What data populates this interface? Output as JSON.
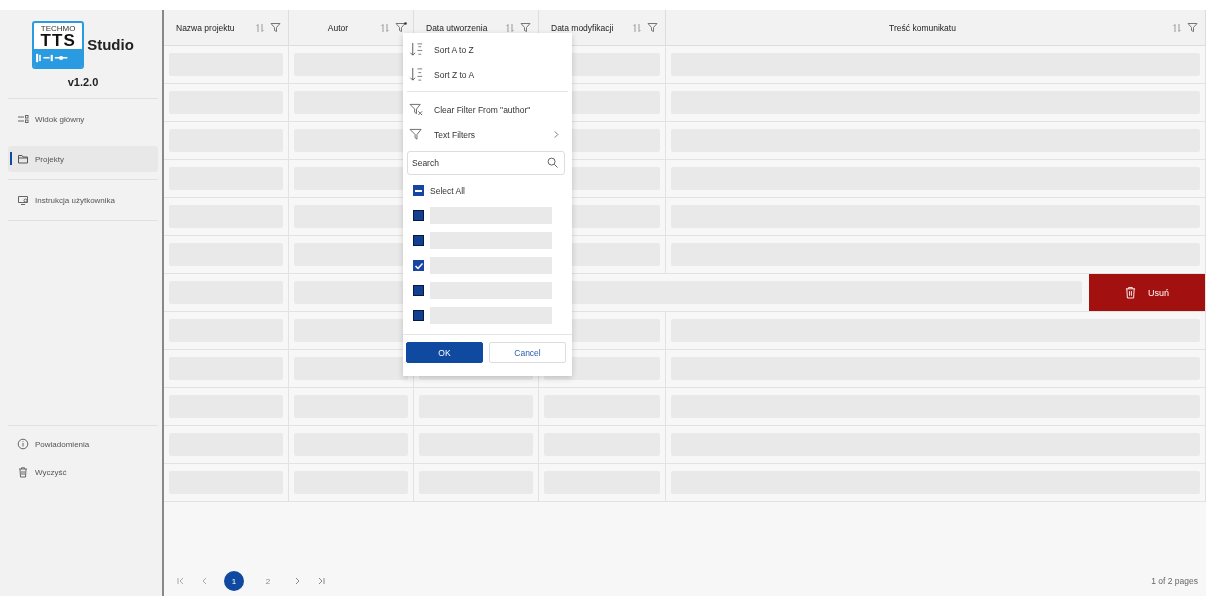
{
  "sidebar": {
    "logo": {
      "brand": "TECHMO",
      "product": "TTS",
      "suffix": "Studio"
    },
    "version": "v1.2.0",
    "nav": [
      {
        "label": "Widok główny",
        "selected": false
      },
      {
        "label": "Projekty",
        "selected": true
      },
      {
        "label": "Instrukcja użytkownika",
        "selected": false
      }
    ],
    "bottom": [
      {
        "label": "Powiadomienia"
      },
      {
        "label": "Wyczyść"
      }
    ]
  },
  "table": {
    "columns": [
      {
        "label": "Nazwa projektu",
        "filtered": false
      },
      {
        "label": "Autor",
        "filtered": true
      },
      {
        "label": "Data utworzenia",
        "filtered": false
      },
      {
        "label": "Data modyfikacji",
        "filtered": false
      },
      {
        "label": "Treść komunikatu",
        "filtered": false
      }
    ],
    "rows": [
      {
        "kind": "loading"
      },
      {
        "kind": "loading"
      },
      {
        "kind": "loading"
      },
      {
        "kind": "loading"
      },
      {
        "kind": "loading"
      },
      {
        "kind": "loading"
      },
      {
        "kind": "swiped",
        "action": "Usuń"
      },
      {
        "kind": "loading"
      },
      {
        "kind": "loading"
      },
      {
        "kind": "loading"
      },
      {
        "kind": "loading"
      },
      {
        "kind": "loading"
      }
    ]
  },
  "filter_menu": {
    "sort_items": [
      {
        "label": "Sort A to Z"
      },
      {
        "label": "Sort Z to A"
      }
    ],
    "clear_filter": "Clear Filter From \"author\"",
    "text_filters": "Text Filters",
    "search": {
      "placeholder": "Search"
    },
    "select_all": {
      "label": "Select All",
      "indeterminate": true
    },
    "values": [
      {
        "checked": false
      },
      {
        "checked": false
      },
      {
        "checked": true
      },
      {
        "checked": false
      },
      {
        "checked": false
      }
    ],
    "ok": "OK",
    "cancel": "Cancel"
  },
  "pagination": {
    "pages": [
      {
        "label": "1",
        "selected": true
      },
      {
        "label": "2",
        "selected": false
      }
    ],
    "summary": "1 of 2 pages"
  }
}
